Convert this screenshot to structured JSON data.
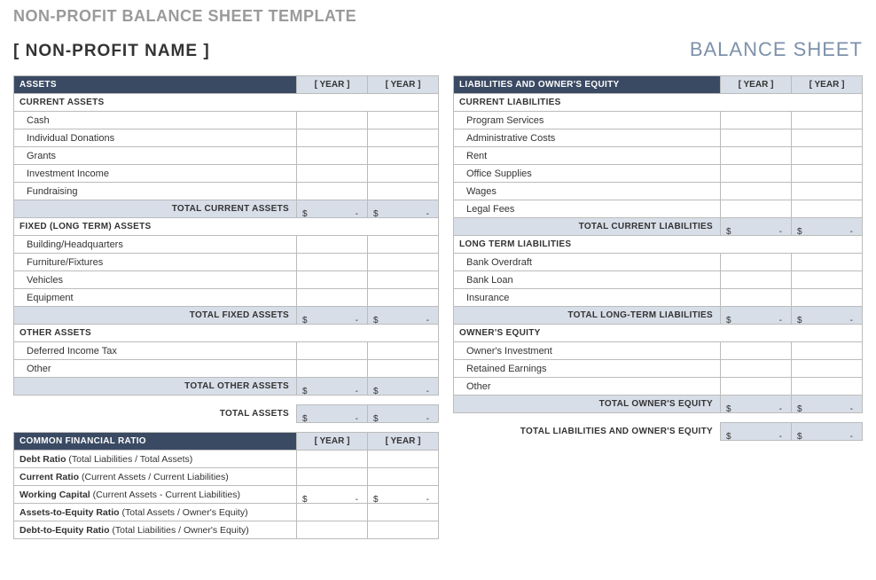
{
  "template_title": "NON-PROFIT BALANCE SHEET TEMPLATE",
  "org_name": "[ NON-PROFIT NAME ]",
  "sheet_type": "BALANCE SHEET",
  "year_label": "[ YEAR ]",
  "dollar": "$",
  "dash": "-",
  "assets": {
    "header": "ASSETS",
    "current": {
      "title": "CURRENT ASSETS",
      "items": [
        "Cash",
        "Individual Donations",
        "Grants",
        "Investment Income",
        "Fundraising"
      ],
      "total": "TOTAL CURRENT ASSETS"
    },
    "fixed": {
      "title": "FIXED (LONG TERM) ASSETS",
      "items": [
        "Building/Headquarters",
        "Furniture/Fixtures",
        "Vehicles",
        "Equipment"
      ],
      "total": "TOTAL FIXED ASSETS"
    },
    "other": {
      "title": "OTHER ASSETS",
      "items": [
        "Deferred Income Tax",
        "Other"
      ],
      "total": "TOTAL OTHER ASSETS"
    },
    "grand_total": "TOTAL ASSETS"
  },
  "liabilities": {
    "header": "LIABILITIES AND OWNER'S EQUITY",
    "current": {
      "title": "CURRENT LIABILITIES",
      "items": [
        "Program Services",
        "Administrative Costs",
        "Rent",
        "Office Supplies",
        "Wages",
        "Legal Fees"
      ],
      "total": "TOTAL CURRENT LIABILITIES"
    },
    "longterm": {
      "title": "LONG TERM LIABILITIES",
      "items": [
        "Bank Overdraft",
        "Bank Loan",
        "Insurance"
      ],
      "total": "TOTAL LONG-TERM LIABILITIES"
    },
    "equity": {
      "title": "OWNER'S EQUITY",
      "items": [
        "Owner's Investment",
        "Retained Earnings",
        "Other"
      ],
      "total": "TOTAL OWNER'S EQUITY"
    },
    "grand_total": "TOTAL LIABILITIES AND OWNER'S EQUITY"
  },
  "ratios": {
    "header": "COMMON FINANCIAL RATIO",
    "items": [
      {
        "name": "Debt Ratio",
        "desc": "(Total Liabilities / Total Assets)",
        "money": false
      },
      {
        "name": "Current Ratio",
        "desc": "(Current Assets / Current Liabilities)",
        "money": false
      },
      {
        "name": "Working Capital",
        "desc": "(Current Assets - Current Liabilities)",
        "money": true
      },
      {
        "name": "Assets-to-Equity Ratio",
        "desc": "(Total Assets / Owner's Equity)",
        "money": false
      },
      {
        "name": "Debt-to-Equity Ratio",
        "desc": "(Total Liabilities / Owner's Equity)",
        "money": false
      }
    ]
  }
}
